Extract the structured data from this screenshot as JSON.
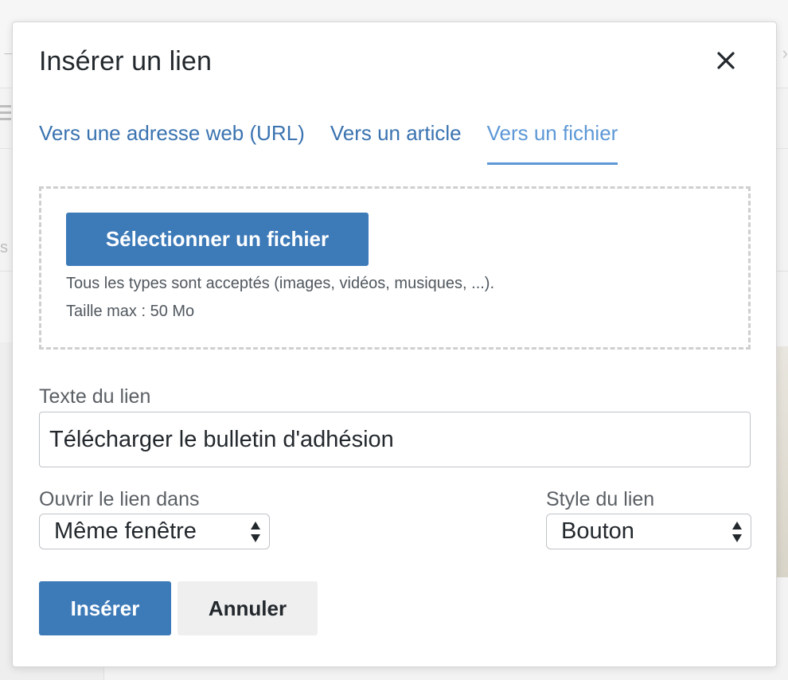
{
  "dialog": {
    "title": "Insérer un lien",
    "close_icon": "close-icon"
  },
  "tabs": [
    {
      "label": "Vers une adresse web (URL)",
      "active": false
    },
    {
      "label": "Vers un article",
      "active": false
    },
    {
      "label": "Vers un fichier",
      "active": true
    }
  ],
  "upload": {
    "button_label": "Sélectionner un fichier",
    "hint_types": "Tous les types sont acceptés (images, vidéos, musiques, ...).",
    "hint_size": "Taille max : 50 Mo"
  },
  "link_text": {
    "label": "Texte du lien",
    "value": "Télécharger le bulletin d'adhésion"
  },
  "open_in": {
    "label": "Ouvrir le lien dans",
    "selected": "Même fenêtre"
  },
  "link_style": {
    "label": "Style du lien",
    "selected": "Bouton"
  },
  "actions": {
    "insert_label": "Insérer",
    "cancel_label": "Annuler"
  },
  "colors": {
    "primary": "#3d7ab8",
    "tab_link": "#3a73b0",
    "tab_active": "#5d98d6"
  }
}
